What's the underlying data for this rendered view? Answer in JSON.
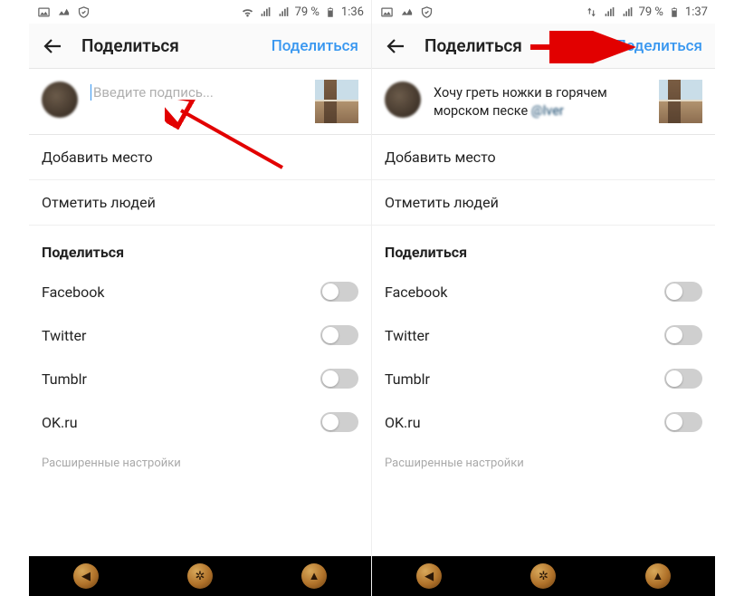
{
  "left": {
    "status": {
      "battery": "79 %",
      "time": "1:36"
    },
    "appbar": {
      "title": "Поделиться",
      "action": "Поделиться"
    },
    "caption": {
      "placeholder": "Введите подпись..."
    },
    "rows": {
      "add_location": "Добавить место",
      "tag_people": "Отметить людей"
    },
    "share": {
      "title": "Поделиться",
      "services": [
        "Facebook",
        "Twitter",
        "Tumblr",
        "OK.ru"
      ]
    },
    "advanced": "Расширенные настройки"
  },
  "right": {
    "status": {
      "battery": "79 %",
      "time": "1:37"
    },
    "appbar": {
      "title": "Поделиться",
      "action": "Поделиться"
    },
    "caption": {
      "text_prefix": "Хочу греть ножки в горячем морском песке ",
      "mention": "@lver"
    },
    "rows": {
      "add_location": "Добавить место",
      "tag_people": "Отметить людей"
    },
    "share": {
      "title": "Поделиться",
      "services": [
        "Facebook",
        "Twitter",
        "Tumblr",
        "OK.ru"
      ]
    },
    "advanced": "Расширенные настройки"
  },
  "colors": {
    "accent": "#3897f0"
  }
}
